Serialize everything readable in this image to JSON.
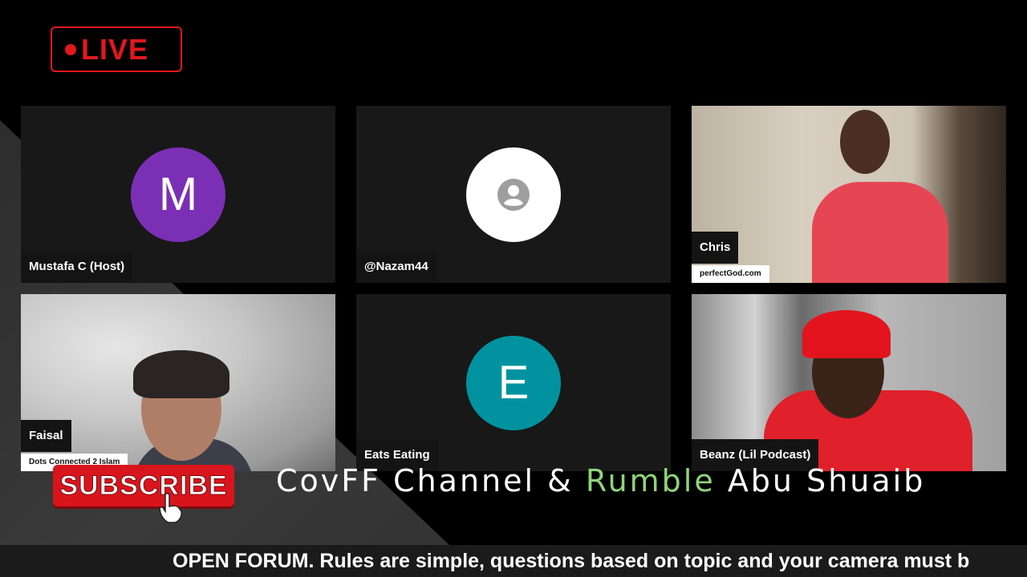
{
  "live": {
    "label": "LIVE",
    "color": "#e0181e"
  },
  "tiles": [
    {
      "name": "Mustafa C (Host)",
      "avatar_letter": "M",
      "avatar_color": "#7b2fb5"
    },
    {
      "name": "@Nazam44",
      "avatar_icon": "person-icon",
      "avatar_color": "#ffffff"
    },
    {
      "name": "Chris",
      "sub_label": "perfectGod.com",
      "video": true
    },
    {
      "name": "Faisal",
      "sub_label": "Dots Connected 2 Islam",
      "video": true
    },
    {
      "name": "Eats Eating",
      "avatar_letter": "E",
      "avatar_color": "#00939f"
    },
    {
      "name": "Beanz (Lil Podcast)",
      "video": true
    }
  ],
  "overlay": {
    "subscribe_label": "SUBSCRIBE",
    "channel_part1": "CovFF Channel & ",
    "channel_green": "Rumble",
    "channel_part2": " Abu Shuaib",
    "ticker": "OPEN FORUM. Rules are simple, questions based on topic and your camera must b"
  }
}
